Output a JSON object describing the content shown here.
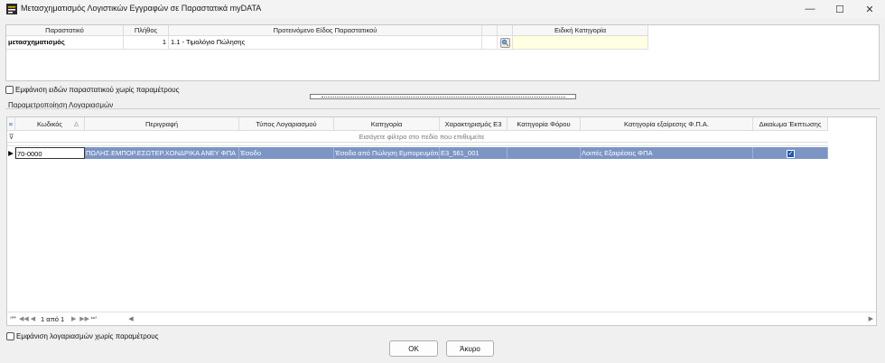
{
  "window": {
    "title": "Μετασχηματισμός Λογιστικών Εγγραφών σε Παραστατικά myDATA",
    "minimize": "—",
    "maximize": "☐",
    "close": "✕"
  },
  "top_grid": {
    "columns": [
      "Παραστατικό",
      "Πλήθος",
      "Προτεινόμενο Είδος Παραστατικού",
      "",
      "",
      "Ειδική Κατηγορία"
    ],
    "row": {
      "document": "μετασχηματισμός",
      "count": "1",
      "suggested_type": "1.1 - Τιμολόγιο Πώλησης",
      "special_category": ""
    }
  },
  "show_doc_types_without_params": "Εμφάνιση ειδών παραστατικού χωρίς παραμέτρους",
  "accounts_group_label": "Παραμετροποίηση Λογαριασμών",
  "accounts_grid": {
    "columns": {
      "code": "Κωδικός",
      "code_sort": "Δ",
      "description": "Περιγραφή",
      "account_type": "Τύπος Λογαριασμού",
      "category": "Κατηγορία",
      "e3_char": "Χαρακτηρισμός Ε3",
      "tax_category": "Κατηγορία Φόρου",
      "vat_exemption": "Κατηγορία εξαίρεσης Φ.Π.Α.",
      "deduction_right": "Δικαίωμα Έκπτωσης"
    },
    "filter_hint": "Εισάγετε φίλτρο στο πεδίο που επιθυμείτε",
    "rows": [
      {
        "indicator": "▶",
        "code": "70-0000",
        "description": "ΠΩΛΗΣ.ΕΜΠΟΡ.ΕΣΩΤΕΡ.ΧΟΝΔΡΙΚΑ ΑΝΕΥ ΦΠΑ",
        "account_type": "Έσοδο",
        "category": "Έσοδα από Πώληση Εμπορευμάτων",
        "e3_char": "Ε3_561_001",
        "tax_category": "",
        "vat_exemption": "Λοιπές Εξαιρέσεις ΦΠΑ",
        "deduction_right": true
      }
    ],
    "pager": {
      "first": "⏮",
      "prev_page": "◀◀",
      "prev": "◀",
      "text": "1 από 1",
      "next": "▶",
      "next_page": "▶▶",
      "last": "⏭",
      "scroll_left": "◀",
      "scroll_right": "▶"
    }
  },
  "show_accounts_without_params": "Εμφάνιση λογαριασμών χωρίς παραμέτρους",
  "buttons": {
    "ok": "ΟΚ",
    "cancel": "Άκυρο"
  },
  "colors": {
    "selected_row": "#7c95c4",
    "checkbox_checked": "#1e5ab4",
    "special_category_cell": "#ffffe1"
  }
}
